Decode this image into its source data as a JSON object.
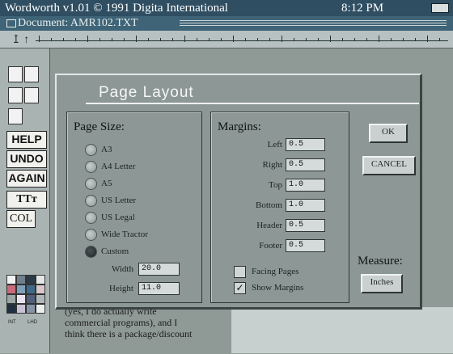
{
  "window": {
    "title": "Wordworth v1.01 © 1991 Digita International",
    "clock": "8:12 PM",
    "document_label": "Document: AMR102.TXT"
  },
  "toolbar": {
    "help": "HELP",
    "undo": "UNDO",
    "again": "AGAIN",
    "text_style": "TTт",
    "col": "COL",
    "palette_colors": [
      "#f2f2f2",
      "#6f7f8c",
      "#2a3a46",
      "#e2e6e6",
      "#c86a7a",
      "#7fa0b8",
      "#3c6a88",
      "#d9c8c9",
      "#9aa7a6",
      "#e8e4ef",
      "#50607a",
      "#b0b8b7",
      "#203040",
      "#c9c2d6",
      "#8494a6",
      "#ecefef"
    ],
    "small_labels": [
      "INT",
      "LHD"
    ]
  },
  "dialog": {
    "title": "Page Layout",
    "page_size": {
      "heading": "Page Size:",
      "options": [
        {
          "label": "A3",
          "selected": false
        },
        {
          "label": "A4 Letter",
          "selected": false
        },
        {
          "label": "A5",
          "selected": false
        },
        {
          "label": "US Letter",
          "selected": false
        },
        {
          "label": "US Legal",
          "selected": false
        },
        {
          "label": "Wide Tractor",
          "selected": false
        },
        {
          "label": "Custom",
          "selected": true
        }
      ],
      "width_label": "Width",
      "width_value": "20.0",
      "height_label": "Height",
      "height_value": "11.0"
    },
    "margins": {
      "heading": "Margins:",
      "fields": [
        {
          "label": "Left",
          "value": "0.5"
        },
        {
          "label": "Right",
          "value": "0.5"
        },
        {
          "label": "Top",
          "value": "1.0"
        },
        {
          "label": "Bottom",
          "value": "1.0"
        },
        {
          "label": "Header",
          "value": "0.5"
        },
        {
          "label": "Footer",
          "value": "0.5"
        }
      ],
      "facing_pages_label": "Facing Pages",
      "facing_pages_checked": false,
      "show_margins_label": "Show Margins",
      "show_margins_checked": true
    },
    "ok_label": "OK",
    "cancel_label": "CANCEL",
    "measure_label": "Measure:",
    "measure_value": "Inches"
  },
  "document_text": [
    "(yes, I do actually write",
    "commercial programs), and I",
    "think there is a package/discount"
  ]
}
